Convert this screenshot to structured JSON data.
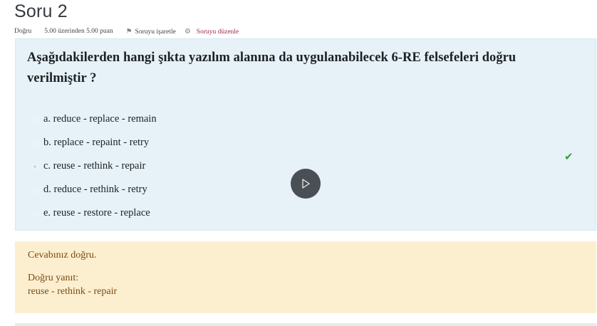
{
  "question": {
    "title": "Soru 2",
    "status": "Doğru",
    "score": "5.00 üzerinden 5.00 puan",
    "flag_label": "Soruyu işaretle",
    "edit_label": "Soruyu düzenle",
    "text": "Aşağıdakilerden hangi şıkta yazılım alanına da uygulanabilecek 6-RE felsefeleri doğru verilmiştir ?",
    "answers": [
      {
        "label": "a. reduce - replace - remain",
        "selected": false
      },
      {
        "label": "b. replace - repaint - retry",
        "selected": false
      },
      {
        "label": "c. reuse - rethink - repair",
        "selected": true
      },
      {
        "label": "d. reduce - rethink - retry",
        "selected": false
      },
      {
        "label": "e. reuse - restore - replace",
        "selected": false
      }
    ],
    "correct_icon": "checkmark-icon"
  },
  "feedback": {
    "message": "Cevabınız doğru.",
    "right_answer_label": "Doğru yanıt:",
    "right_answer": "reuse - rethink - repair"
  },
  "overlay": {
    "icon": "play-icon"
  },
  "colors": {
    "question_bg": "#e6f2f7",
    "feedback_bg": "#fcefd0",
    "correct": "#3c9c3c",
    "edit_link": "#9c2a3e"
  }
}
